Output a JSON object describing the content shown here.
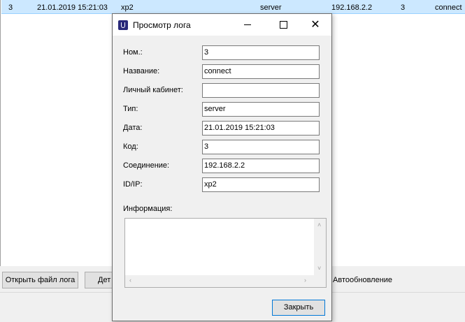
{
  "background": {
    "row": {
      "num": "3",
      "date": "21.01.2019 15:21:03",
      "id": "xp2",
      "type": "server",
      "ip": "192.168.2.2",
      "code": "3",
      "name": "connect"
    },
    "buttons": {
      "open_log": "Открыть файл лога",
      "details_partial": "Дет"
    },
    "auto_refresh": "Автообновление"
  },
  "dialog": {
    "title": "Просмотр лога",
    "fields": [
      {
        "label": "Ном.:",
        "value": "3"
      },
      {
        "label": "Название:",
        "value": "connect"
      },
      {
        "label": "Личный кабинет:",
        "value": ""
      },
      {
        "label": "Тип:",
        "value": "server"
      },
      {
        "label": "Дата:",
        "value": "21.01.2019 15:21:03"
      },
      {
        "label": "Код:",
        "value": "3"
      },
      {
        "label": "Соединение:",
        "value": "192.168.2.2"
      },
      {
        "label": "ID/IP:",
        "value": "xp2"
      }
    ],
    "info_label": "Информация:",
    "info_text": "",
    "close_label": "Закрыть"
  }
}
